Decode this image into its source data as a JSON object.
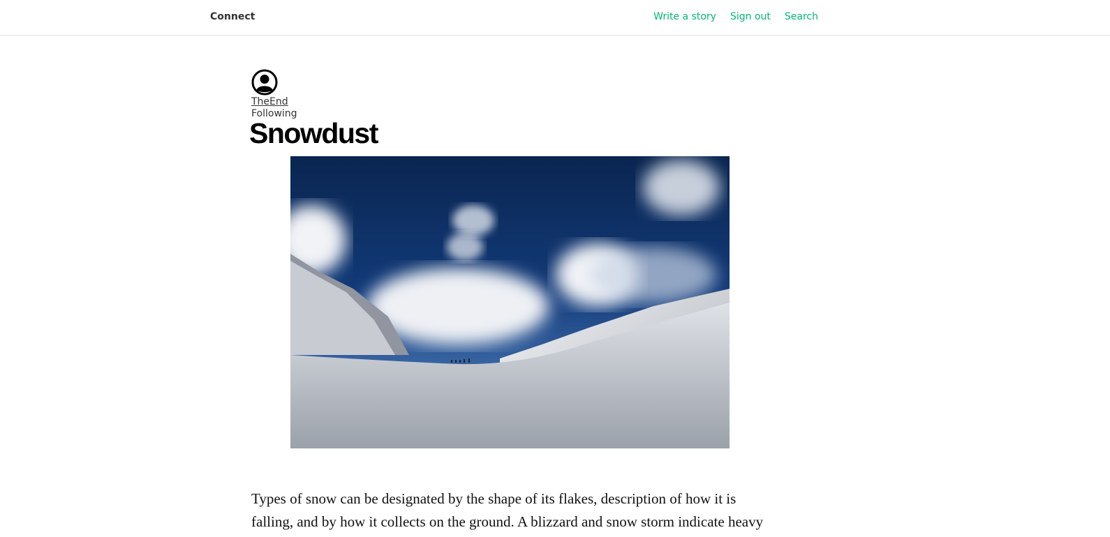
{
  "header": {
    "brand": "Connect",
    "nav": {
      "write": "Write a story",
      "signout": "Sign out",
      "search": "Search"
    }
  },
  "author": {
    "name": "TheEnd",
    "follow_status": "Following",
    "avatar_icon": "user-avatar-icon"
  },
  "article": {
    "title": "Snowdust",
    "image_icon": "snowy-mountain-valley-photo",
    "body": "Types of snow can be designated by the shape of its flakes, description of how it is falling, and by how it collects on the ground. A blizzard and snow storm indicate heavy"
  },
  "colors": {
    "accent": "#02b875",
    "text": "#333333"
  }
}
